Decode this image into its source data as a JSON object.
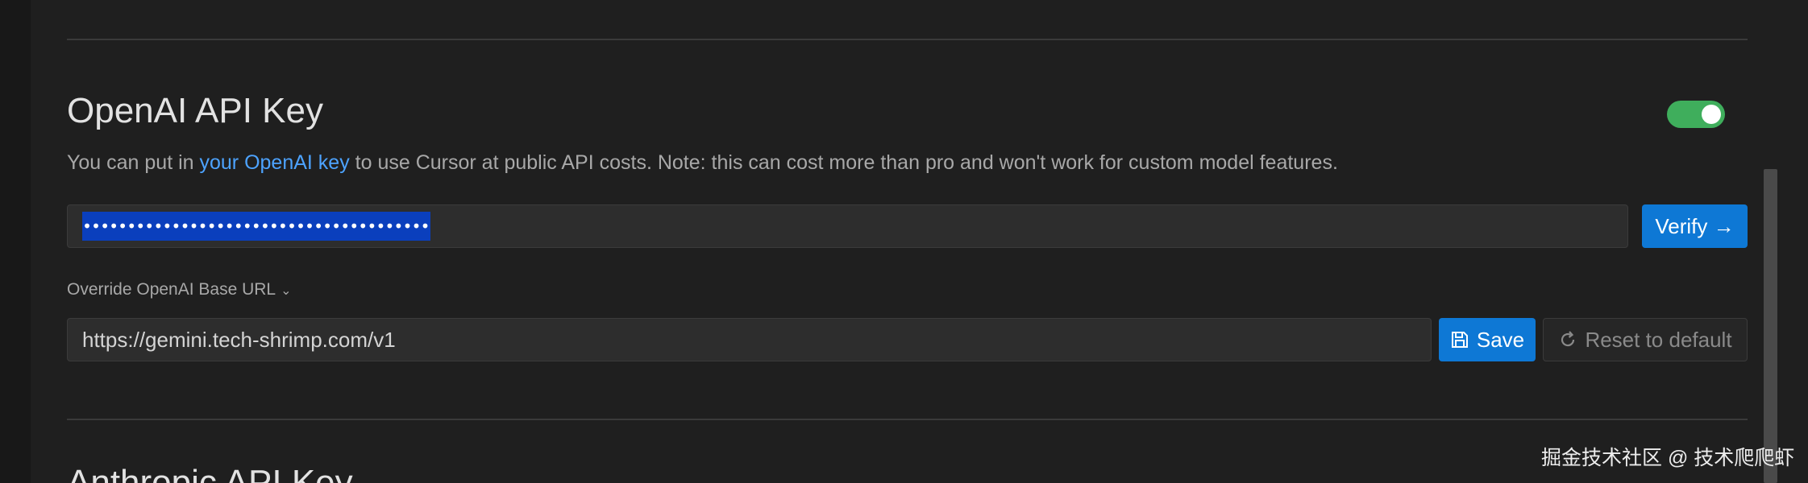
{
  "section": {
    "title": "OpenAI API Key",
    "toggle_enabled": true,
    "description_before": "You can put in ",
    "description_link": "your OpenAI key",
    "description_after": " to use Cursor at public API costs. Note: this can cost more than pro and won't work for custom model features."
  },
  "api_key": {
    "masked_value": "••••••••••••••••••••••••••••••••••••••••••",
    "verify_label": "Verify →"
  },
  "base_url": {
    "label": "Override OpenAI Base URL",
    "value": "https://gemini.tech-shrimp.com/v1",
    "save_label": "Save",
    "reset_label": "Reset to default"
  },
  "next_section": {
    "title": "Anthropic API Key"
  },
  "watermark": "掘金技术社区 @ 技术爬爬虾",
  "colors": {
    "background": "#1f1f1f",
    "accent": "#0e78d5",
    "link": "#4da3ff",
    "toggle_on": "#3fae5c",
    "selection": "#0a3fbd"
  },
  "icons": {
    "toggle": "toggle-switch-icon",
    "verify": "arrow-right-icon",
    "save": "floppy-disk-icon",
    "reset": "refresh-icon",
    "dropdown": "chevron-down-icon"
  }
}
